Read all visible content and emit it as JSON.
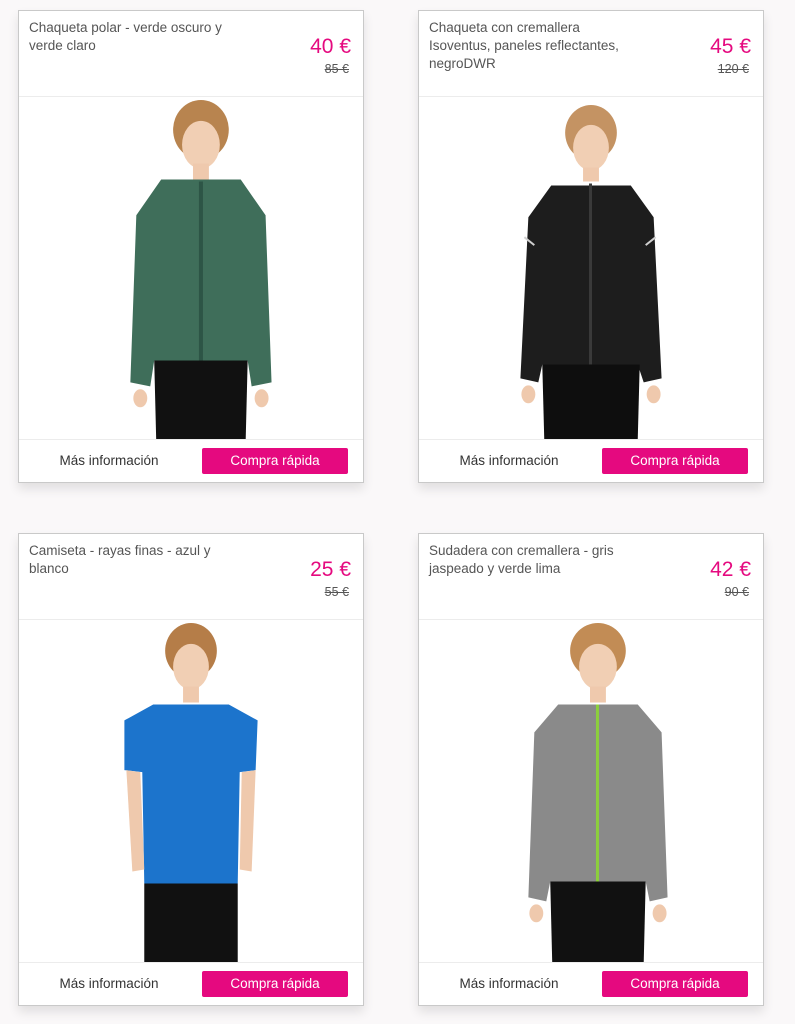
{
  "products": [
    {
      "title": "Chaqueta polar - verde oscuro y verde claro",
      "price": "40 €",
      "old_price": "85 €",
      "more_info_label": "Más información",
      "quick_buy_label": "Compra rápida",
      "garment_color": "#3f6e5a",
      "zip_color": "#2d5546"
    },
    {
      "title": "Chaqueta con cremallera Isoventus, paneles reflectantes, negroDWR",
      "price": "45 €",
      "old_price": "120 €",
      "more_info_label": "Más información",
      "quick_buy_label": "Compra rápida",
      "garment_color": "#1d1d1d",
      "zip_color": "#3a3a3a"
    },
    {
      "title": "Camiseta - rayas finas - azul y blanco",
      "price": "25 €",
      "old_price": "55 €",
      "more_info_label": "Más información",
      "quick_buy_label": "Compra rápida",
      "garment_color": "#1c74cc",
      "zip_color": "#1c74cc"
    },
    {
      "title": "Sudadera con cremallera - gris jaspeado y verde lima",
      "price": "42 €",
      "old_price": "90 €",
      "more_info_label": "Más información",
      "quick_buy_label": "Compra rápida",
      "garment_color": "#8a8a8a",
      "zip_color": "#8ccf3c"
    }
  ],
  "colors": {
    "accent": "#e5097f"
  }
}
